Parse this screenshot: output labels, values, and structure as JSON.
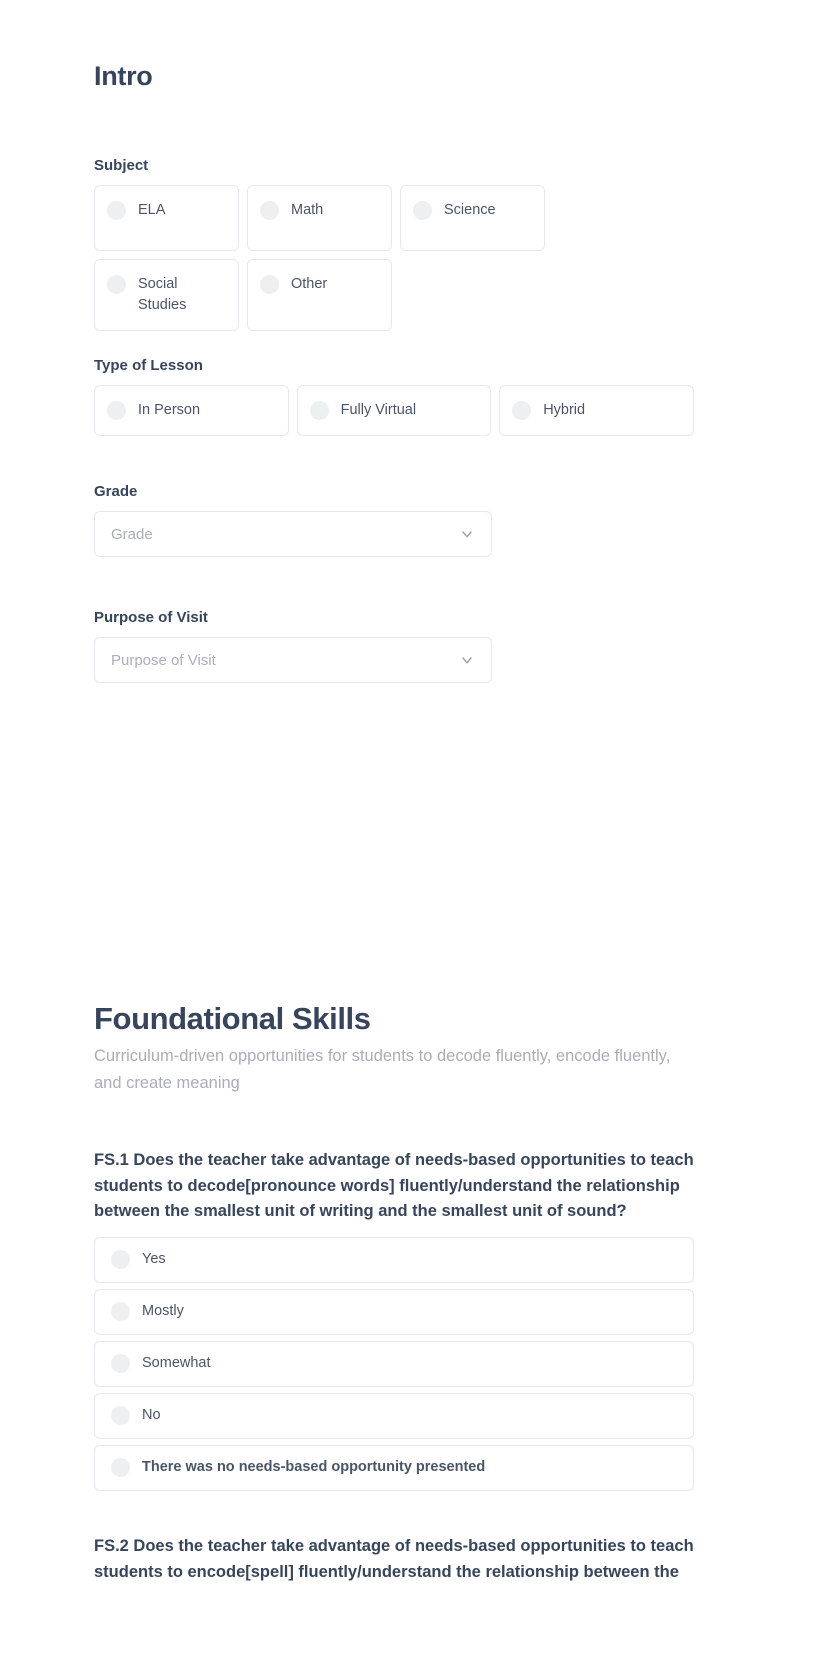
{
  "intro": {
    "title": "Intro",
    "subject": {
      "label": "Subject",
      "options": [
        "ELA",
        "Math",
        "Science",
        "Social Studies",
        "Other"
      ]
    },
    "lesson_type": {
      "label": "Type of Lesson",
      "options": [
        "In Person",
        "Fully Virtual",
        "Hybrid"
      ]
    },
    "grade": {
      "label": "Grade",
      "placeholder": "Grade",
      "value": "",
      "chevron_icon": "chevron-down-icon"
    },
    "purpose": {
      "label": "Purpose of Visit",
      "placeholder": "Purpose of Visit",
      "value": "",
      "chevron_icon": "chevron-down-icon"
    }
  },
  "foundational": {
    "title": "Foundational Skills",
    "subtitle": "Curriculum-driven opportunities for students to decode fluently, encode fluently, and create meaning",
    "questions": [
      {
        "id": "FS.1",
        "text": "FS.1 Does the teacher take advantage of needs-based opportunities to teach students to decode[pronounce words] fluently/understand the relationship between the smallest unit of writing and the smallest unit of sound?",
        "options": [
          "Yes",
          "Mostly",
          "Somewhat",
          "No",
          "There was no needs-based opportunity presented"
        ]
      },
      {
        "id": "FS.2",
        "text": "FS.2 Does the teacher take advantage of needs-based opportunities to teach students to encode[spell] fluently/understand the relationship between the"
      }
    ]
  },
  "colors": {
    "text": "#36455c",
    "muted": "#a8adb8",
    "border": "#e6e8ec",
    "radio": "#eeeff1",
    "background": "#ffffff"
  }
}
